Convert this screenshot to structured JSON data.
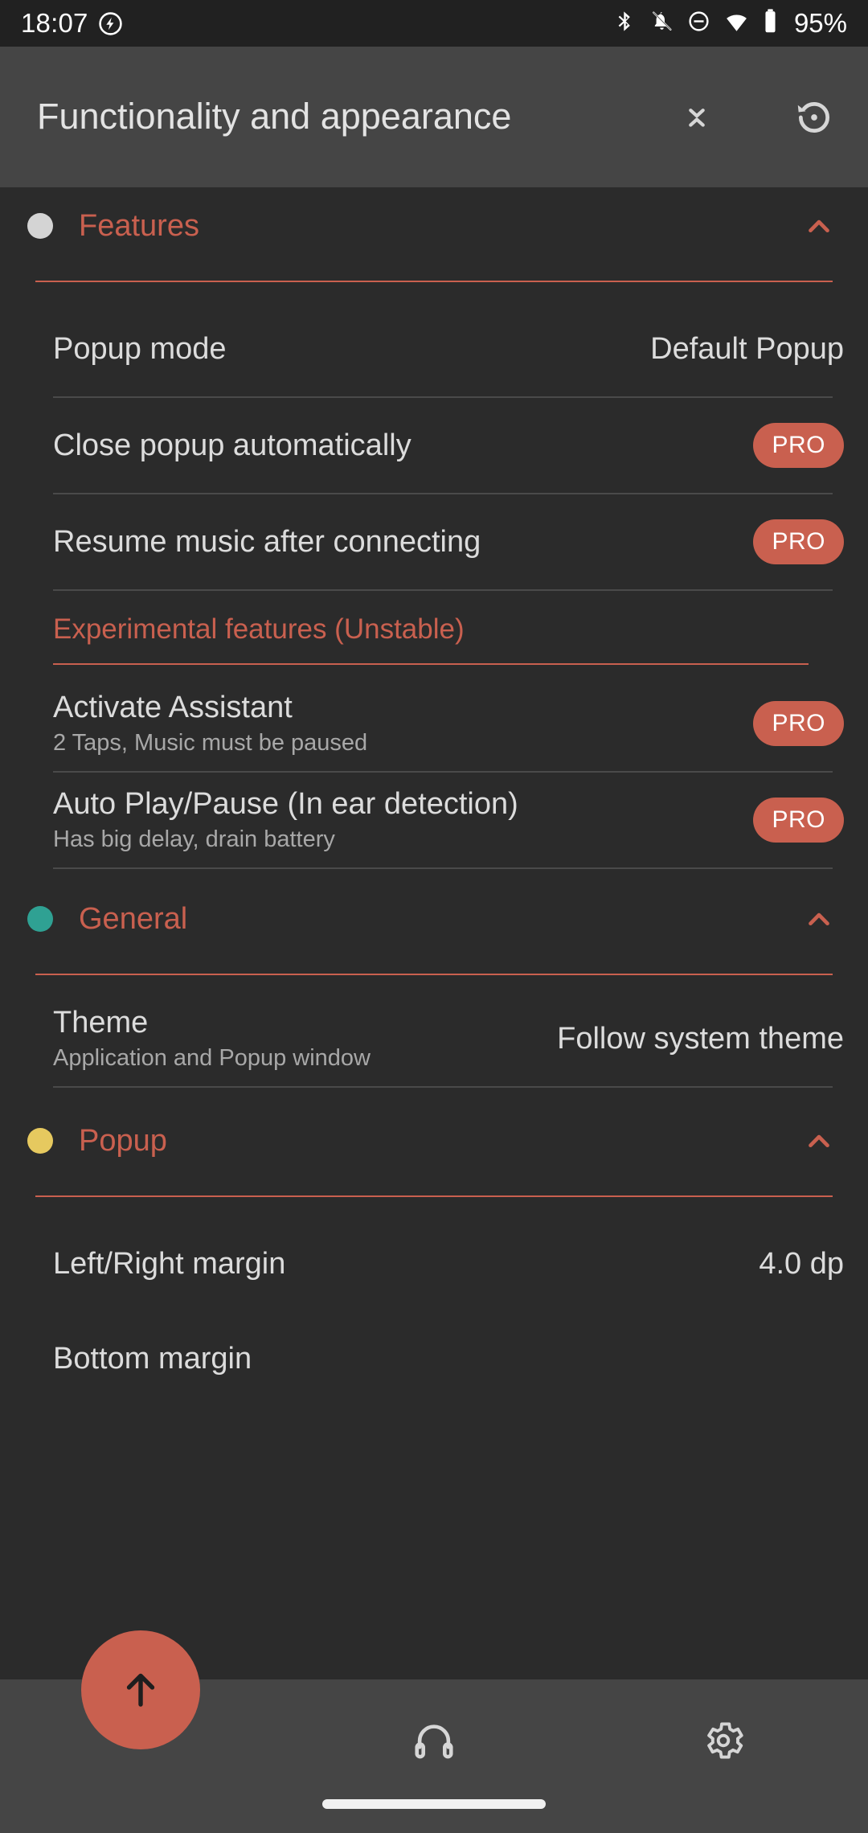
{
  "status_bar": {
    "time": "18:07",
    "flash_icon": "charging-bolt-icon",
    "icons": [
      "bluetooth-icon",
      "notifications-off-icon",
      "do-not-disturb-icon",
      "wifi-icon",
      "battery-icon"
    ],
    "battery_text": "95%"
  },
  "toolbar": {
    "title": "Functionality and appearance",
    "collapse_icon": "collapse-all-icon",
    "restore_icon": "restore-defaults-icon"
  },
  "colors": {
    "accent": "#c9604f",
    "background": "#2b2b2b",
    "surface": "#454545",
    "status_bar": "#212121",
    "text_primary": "#dcdcdc",
    "text_secondary": "#a8a8a8",
    "dot_features": "#d4d4d4",
    "dot_general": "#2fa193",
    "dot_popup": "#e6c95f"
  },
  "sections": [
    {
      "id": "features",
      "title": "Features",
      "dot_color": "#d4d4d4",
      "expanded": true,
      "chevron": "chevron-up-icon",
      "rows": [
        {
          "title": "Popup mode",
          "sub": "",
          "value": "Default Popup",
          "badge": ""
        },
        {
          "title": "Close popup automatically",
          "sub": "",
          "value": "",
          "badge": "PRO"
        },
        {
          "title": "Resume music after connecting",
          "sub": "",
          "value": "",
          "badge": "PRO"
        }
      ],
      "subgroup": {
        "title": "Experimental features (Unstable)",
        "rows": [
          {
            "title": "Activate Assistant",
            "sub": "2 Taps, Music must be paused",
            "value": "",
            "badge": "PRO"
          },
          {
            "title": "Auto Play/Pause (In ear detection)",
            "sub": "Has big delay, drain battery",
            "value": "",
            "badge": "PRO"
          }
        ]
      }
    },
    {
      "id": "general",
      "title": "General",
      "dot_color": "#2fa193",
      "expanded": true,
      "chevron": "chevron-up-icon",
      "rows": [
        {
          "title": "Theme",
          "sub": "Application and Popup window",
          "value": "Follow system theme",
          "badge": ""
        }
      ]
    },
    {
      "id": "popup",
      "title": "Popup",
      "dot_color": "#e6c95f",
      "expanded": true,
      "chevron": "chevron-up-icon",
      "rows": [
        {
          "title": "Left/Right margin",
          "sub": "",
          "value": "4.0 dp",
          "badge": ""
        },
        {
          "title": "Bottom margin",
          "sub": "",
          "value": "",
          "badge": ""
        }
      ]
    }
  ],
  "bottom_bar": {
    "fab_icon": "arrow-up-icon",
    "items": [
      {
        "icon": "headphones-icon",
        "label": ""
      },
      {
        "icon": "gear-icon",
        "label": ""
      }
    ]
  }
}
